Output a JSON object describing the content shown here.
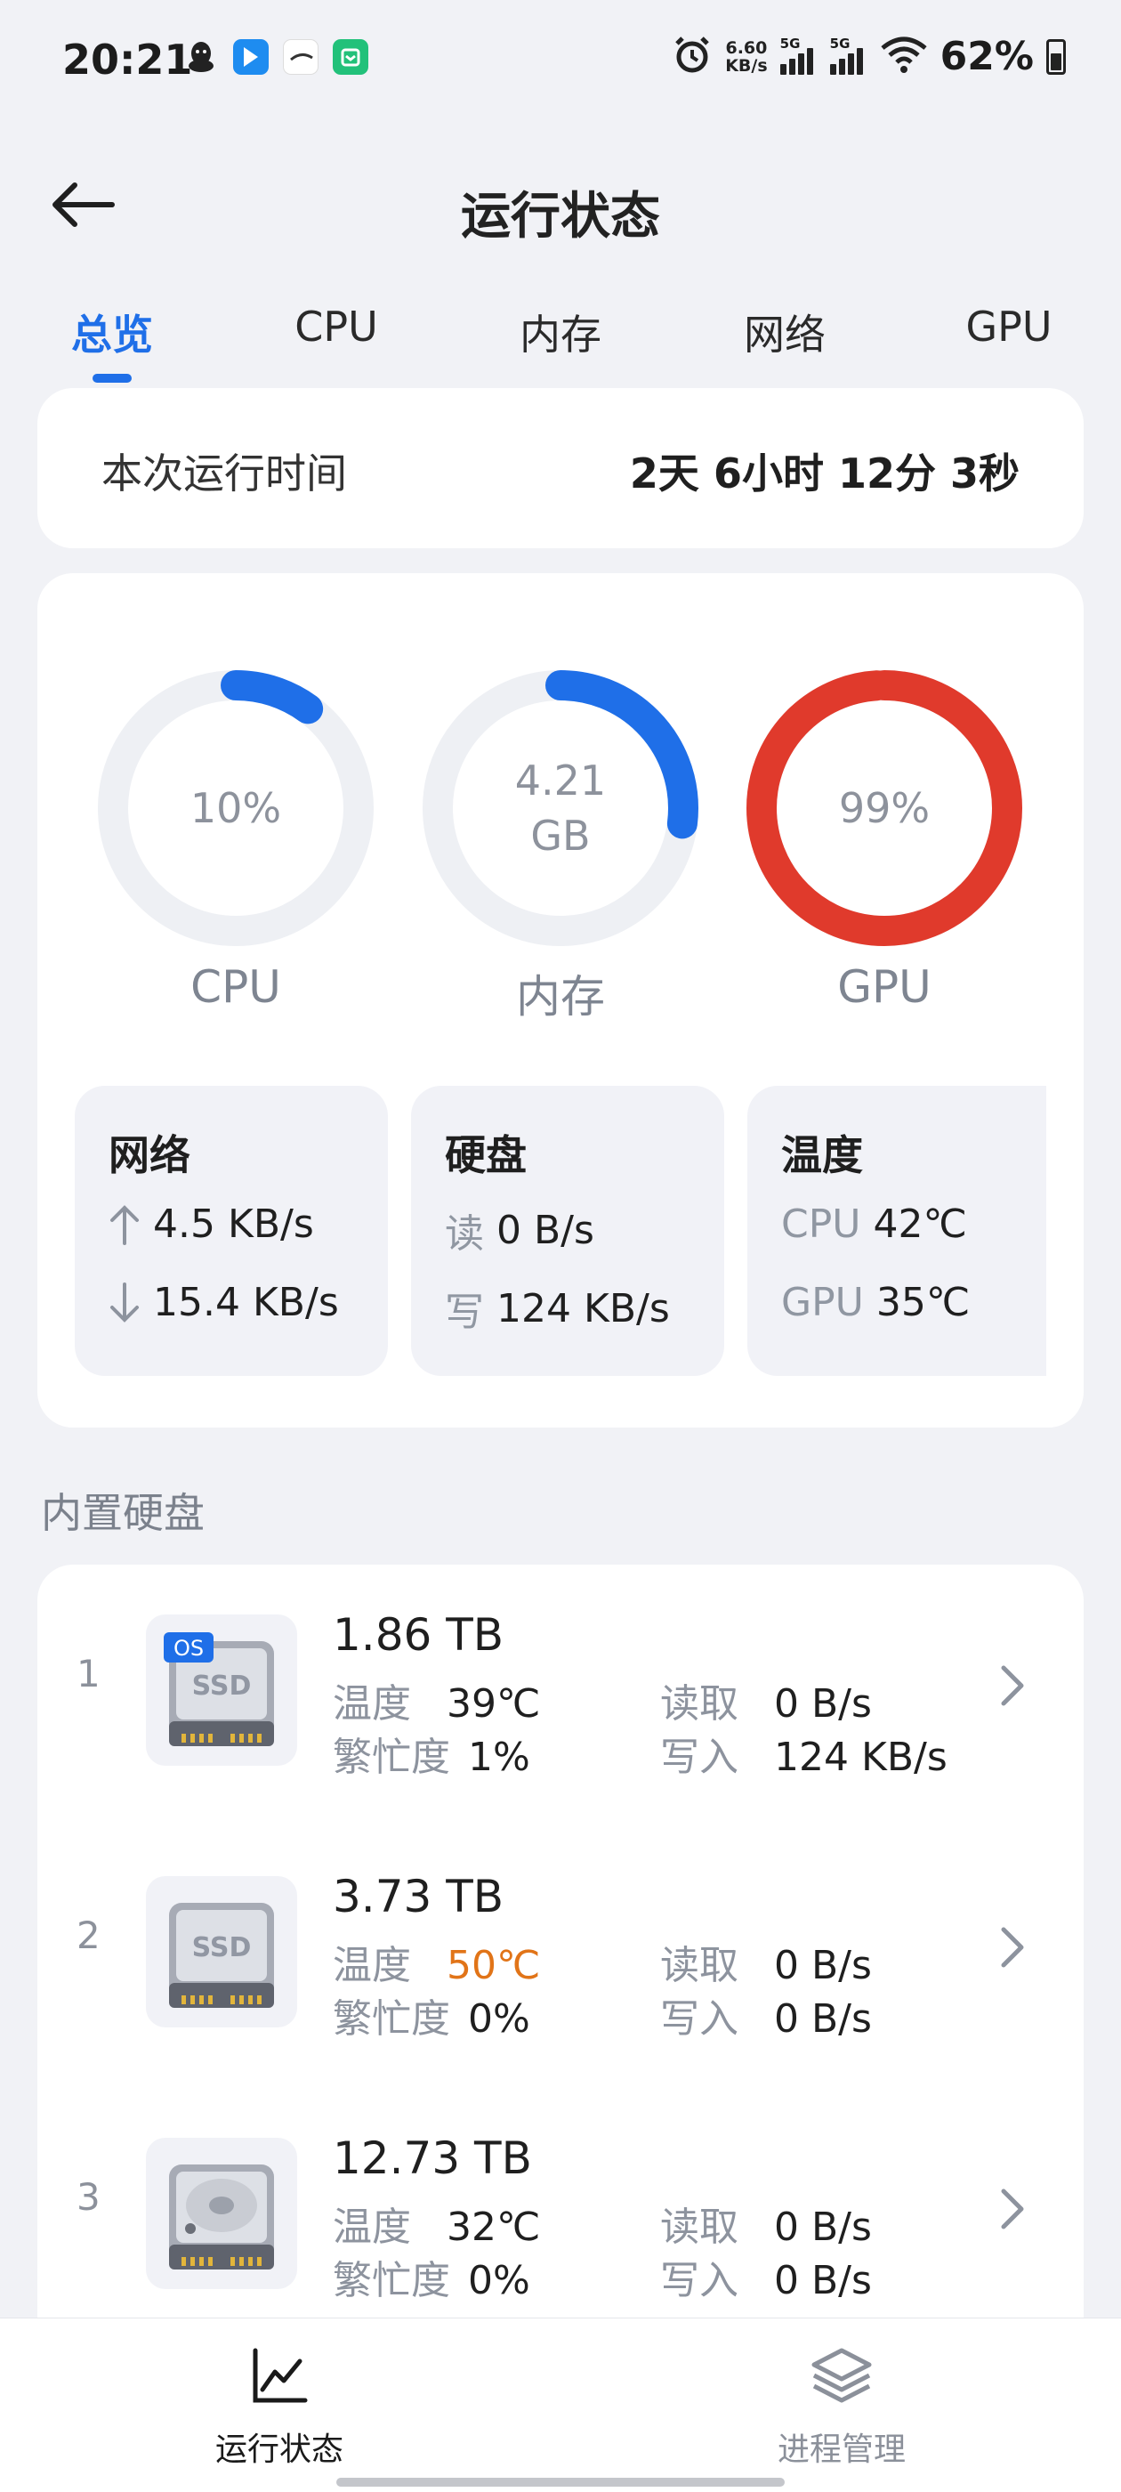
{
  "status_bar": {
    "time": "20:21",
    "net_speed_value": "6.60",
    "net_speed_unit": "KB/s",
    "signal1_label": "5G",
    "signal2_label": "5G",
    "battery": "62%",
    "apps": [
      "qq-icon",
      "feishu-icon",
      "netease-icon",
      "mi-home-icon"
    ]
  },
  "header": {
    "title": "运行状态"
  },
  "tabs": [
    {
      "label": "总览",
      "active": true
    },
    {
      "label": "CPU",
      "active": false
    },
    {
      "label": "内存",
      "active": false
    },
    {
      "label": "网络",
      "active": false
    },
    {
      "label": "GPU",
      "active": false
    }
  ],
  "uptime": {
    "label": "本次运行时间",
    "value": "2天 6小时 12分 3秒"
  },
  "gauges": [
    {
      "name": "CPU",
      "text": "10%",
      "unit": "",
      "fraction": 0.1,
      "color": "#1f6fe8"
    },
    {
      "name": "内存",
      "text": "4.21",
      "unit": "GB",
      "fraction": 0.27,
      "color": "#1f6fe8"
    },
    {
      "name": "GPU",
      "text": "99%",
      "unit": "",
      "fraction": 0.99,
      "color": "#e03a2c"
    }
  ],
  "network": {
    "title": "网络",
    "up": "4.5 KB/s",
    "down": "15.4 KB/s"
  },
  "disk_io": {
    "title": "硬盘",
    "read_label": "读",
    "read": "0 B/s",
    "write_label": "写",
    "write": "124 KB/s"
  },
  "temperature": {
    "title": "温度",
    "cpu_label": "CPU",
    "cpu": "42℃",
    "gpu_label": "GPU",
    "gpu": "35℃"
  },
  "disks_section": {
    "title": "内置硬盘"
  },
  "disk_labels": {
    "temp": "温度",
    "busy": "繁忙度",
    "read": "读取",
    "write": "写入"
  },
  "disks": [
    {
      "index": "1",
      "capacity": "1.86 TB",
      "temp": "39℃",
      "temp_warn": false,
      "busy": "1%",
      "read": "0 B/s",
      "write": "124 KB/s",
      "type": "ssd",
      "os_badge": "OS"
    },
    {
      "index": "2",
      "capacity": "3.73 TB",
      "temp": "50℃",
      "temp_warn": true,
      "busy": "0%",
      "read": "0 B/s",
      "write": "0 B/s",
      "type": "ssd",
      "os_badge": ""
    },
    {
      "index": "3",
      "capacity": "12.73 TB",
      "temp": "32℃",
      "temp_warn": false,
      "busy": "0%",
      "read": "0 B/s",
      "write": "0 B/s",
      "type": "hdd",
      "os_badge": ""
    }
  ],
  "ssd_chip_label": "SSD",
  "bottom_nav": [
    {
      "label": "运行状态",
      "icon": "line-chart-icon",
      "active": true
    },
    {
      "label": "进程管理",
      "icon": "layers-icon",
      "active": false
    }
  ]
}
